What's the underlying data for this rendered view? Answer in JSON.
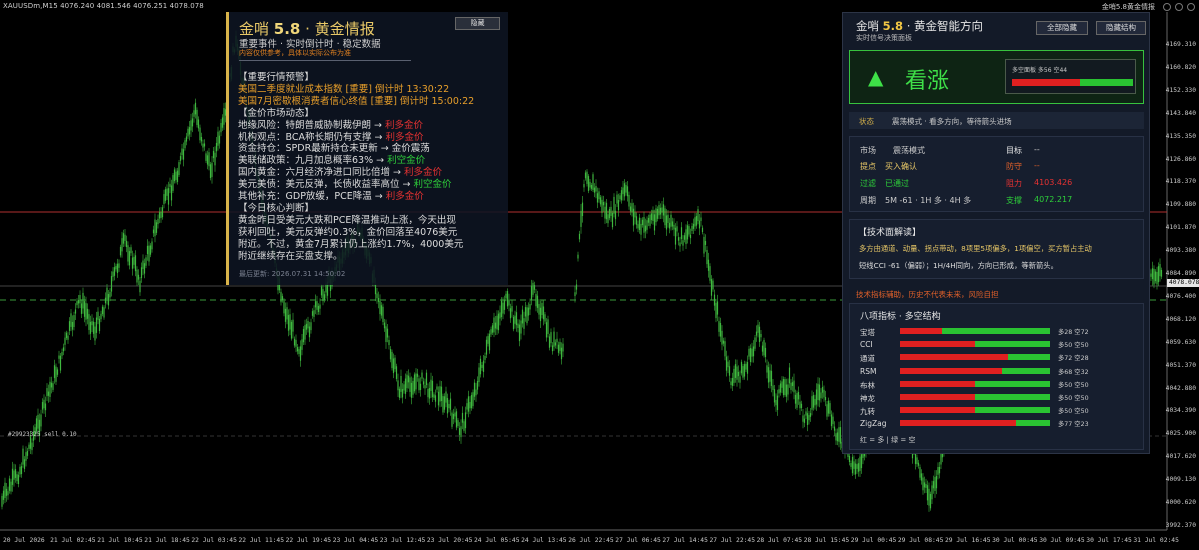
{
  "window": {
    "title": "XAUUSDm,M15  4076.240 4081.546 4076.251 4078.078",
    "brand_right": "金哨5.8黄金情报"
  },
  "chart": {
    "current_price": "4078.078",
    "order_label": "#29923325 sell 0.10",
    "price_labels": [
      "4169.310",
      "4160.820",
      "4152.330",
      "4143.840",
      "4135.350",
      "4126.860",
      "4118.370",
      "4109.880",
      "4101.870",
      "4093.380",
      "4084.890",
      "4076.400",
      "4068.120",
      "4059.630",
      "4051.370",
      "4042.880",
      "4034.390",
      "4025.900",
      "4017.620",
      "4009.130",
      "4000.620",
      "3992.370"
    ],
    "time_labels": [
      "20 Jul 2026",
      "21 Jul 02:45",
      "21 Jul 10:45",
      "21 Jul 18:45",
      "22 Jul 03:45",
      "22 Jul 11:45",
      "22 Jul 19:45",
      "23 Jul 04:45",
      "23 Jul 12:45",
      "23 Jul 20:45",
      "24 Jul 05:45",
      "24 Jul 13:45",
      "26 Jul 22:45",
      "27 Jul 06:45",
      "27 Jul 14:45",
      "27 Jul 22:45",
      "28 Jul 07:45",
      "28 Jul 15:45",
      "29 Jul 00:45",
      "29 Jul 08:45",
      "29 Jul 16:45",
      "30 Jul 00:45",
      "30 Jul 09:45",
      "30 Jul 17:45",
      "31 Jul 02:45"
    ],
    "colors": {
      "candle": "#3fb83f",
      "support_line": "#b03030",
      "current_line": "#3a9a3a"
    }
  },
  "news_panel": {
    "title_prefix": "金哨",
    "title_version": "5.8",
    "title_suffix": "· 黄金情报",
    "subtitle": "重要事件 · 实时倒计时 · 稳定数据",
    "warning": "内容仅供参考，具体以实际公布为准",
    "hide_label": "隐藏",
    "lines": [
      {
        "text": "【重要行情预警】",
        "style": "normal"
      },
      {
        "text": "美国二季度就业成本指数 [重要] 倒计时 13:30:22",
        "style": "orange"
      },
      {
        "text": "美国7月密歇根消费者信心终值 [重要] 倒计时 15:00:22",
        "style": "orange"
      },
      {
        "text": "【金价市场动态】",
        "style": "normal"
      },
      {
        "label": "地缘风险：",
        "body": "特朗普威胁制裁伊朗 →",
        "tag": "利多金价",
        "tag_color": "red"
      },
      {
        "label": "机构观点：",
        "body": "BCA称长期仍有支撑 →",
        "tag": "利多金价",
        "tag_color": "red"
      },
      {
        "label": "资金持仓：",
        "body": "SPDR最新持仓未更新 →",
        "tag": "金价震荡",
        "tag_color": "plain"
      },
      {
        "label": "美联储政策：",
        "body": "九月加息概率63% →",
        "tag": "利空金价",
        "tag_color": "green"
      },
      {
        "label": "国内黄金：",
        "body": "六月经济净进口同比倍增 →",
        "tag": "利多金价",
        "tag_color": "red"
      },
      {
        "label": "美元美债：",
        "body": "美元反弹，长债收益率高位 →",
        "tag": "利空金价",
        "tag_color": "green"
      },
      {
        "label": "其他补充：",
        "body": "GDP放缓，PCE降温 →",
        "tag": "利多金价",
        "tag_color": "red"
      },
      {
        "text": "【今日核心判断】",
        "style": "normal"
      },
      {
        "text": "黄金昨日受美元大跌和PCE降温推动上涨，今天出现",
        "style": "normal"
      },
      {
        "text": "获利回吐，美元反弹约0.3%，金价回落至4076美元",
        "style": "normal"
      },
      {
        "text": "附近。不过，黄金7月累计仍上涨约1.7%，4000美元",
        "style": "normal"
      },
      {
        "text": "附近继续存在买盘支撑。",
        "style": "normal"
      }
    ],
    "updated": "最后更新: 2026.07.31 14:50:02"
  },
  "right_panel": {
    "title_prefix": "金哨",
    "title_version": "5.8",
    "title_suffix": "· 黄金智能方向",
    "subtitle": "实时信号决策面板",
    "btn_hide_all": "全部隐藏",
    "btn_hide_struct": "隐藏结构",
    "trend_arrow": "▲",
    "trend_text": "看涨",
    "trend_mini_label": "多空面板  多56 空44",
    "trend_bull_pct": 56,
    "status_key": "状态",
    "status_value": "震荡模式 · 看多方向，等待箭头进场",
    "info": {
      "market_k": "市场",
      "market_v": "震荡模式",
      "target_k": "目标",
      "target_v": "--",
      "signal_k": "提点",
      "signal_v": "买入确认",
      "defense_k": "防守",
      "defense_v": "--",
      "filter_k": "过滤",
      "filter_v": "已通过",
      "resist_k": "阻力",
      "resist_v": "4103.426",
      "period_k": "周期",
      "period_v": "5M -61 · 1H 多 · 4H 多",
      "support_k": "支撑",
      "support_v": "4072.217"
    },
    "tech_title": "【技术面解读】",
    "tech_line1": "多方由通道、动量、拐点带动，8项里5项偏多，1项偏空，买方暂占主动",
    "tech_line2": "短线CCI -61（偏弱）；1H/4H同向，方向已形成，等新箭头。",
    "risk_note": "技术指标辅助，历史不代表未来，风险自担",
    "indicators_title": "八项指标 · 多空结构",
    "indicators": [
      {
        "name": "宝塔",
        "bull": 28,
        "bear": 72,
        "label": "多28 空72"
      },
      {
        "name": "CCI",
        "bull": 50,
        "bear": 50,
        "label": "多50 空50"
      },
      {
        "name": "通道",
        "bull": 72,
        "bear": 28,
        "label": "多72 空28"
      },
      {
        "name": "RSM",
        "bull": 68,
        "bear": 32,
        "label": "多68 空32"
      },
      {
        "name": "布林",
        "bull": 50,
        "bear": 50,
        "label": "多50 空50"
      },
      {
        "name": "神龙",
        "bull": 50,
        "bear": 50,
        "label": "多50 空50"
      },
      {
        "name": "九转",
        "bull": 50,
        "bear": 50,
        "label": "多50 空50"
      },
      {
        "name": "ZigZag",
        "bull": 77,
        "bear": 23,
        "label": "多77 空23"
      }
    ],
    "legend": "红 = 多  |  绿 = 空"
  }
}
